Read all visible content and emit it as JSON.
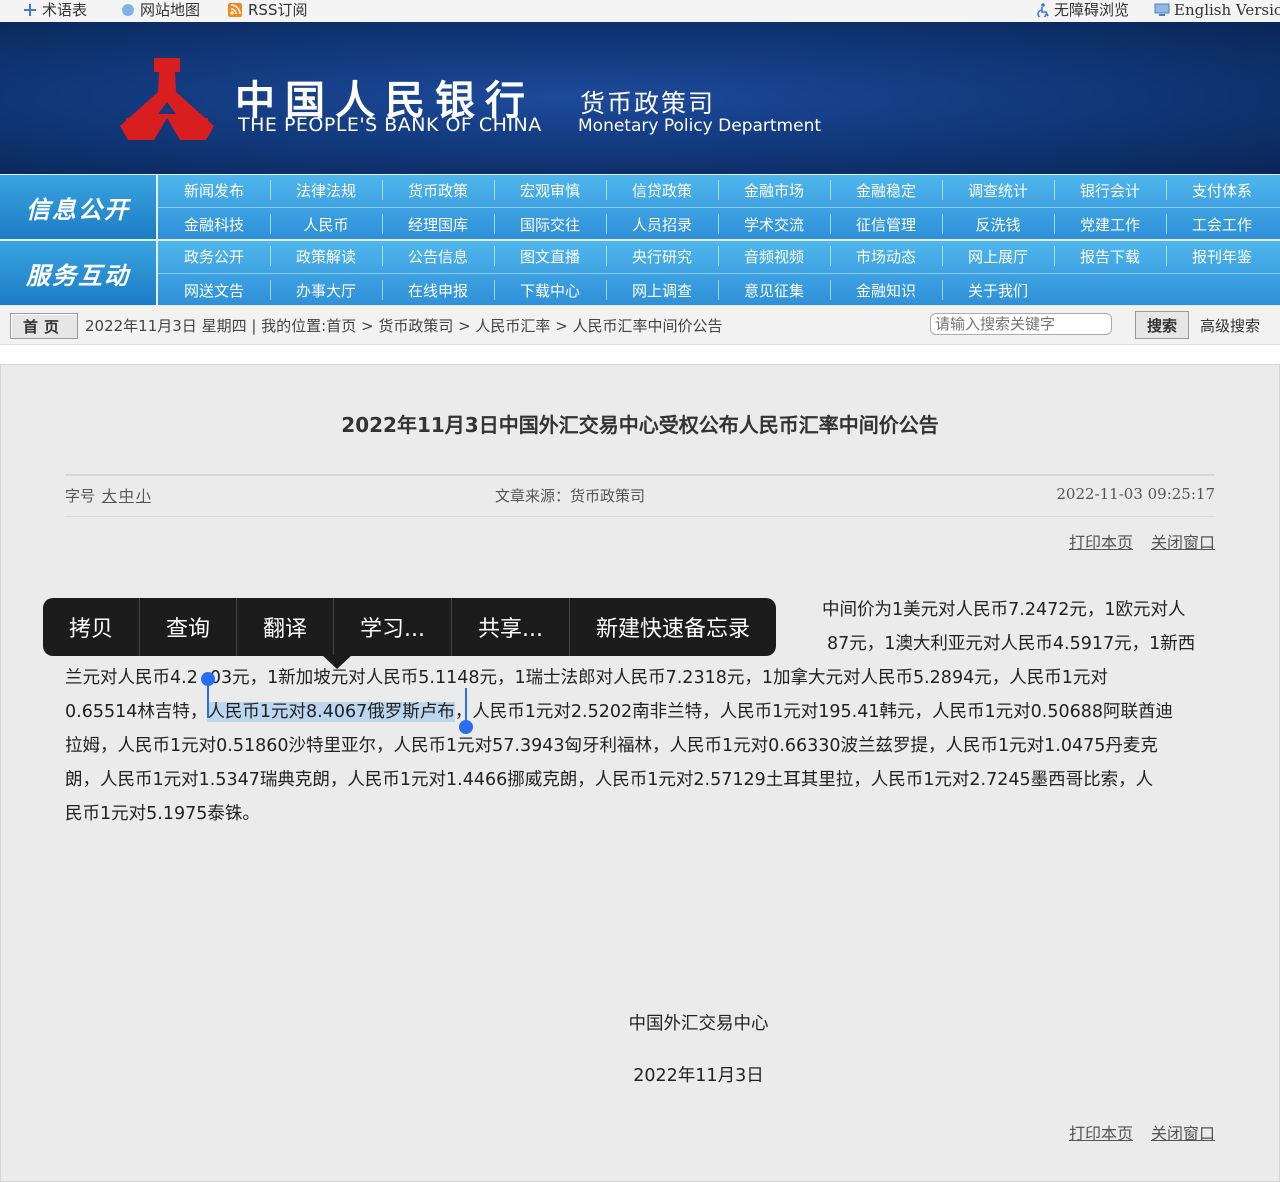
{
  "topbar": {
    "glossary": "术语表",
    "sitemap": "网站地图",
    "rss": "RSS订阅",
    "accessibility": "无障碍浏览",
    "english": "English Version"
  },
  "header": {
    "bank_cn": "中国人民银行",
    "bank_en": "THE PEOPLE'S BANK OF CHINA",
    "dept_cn": "货币政策司",
    "dept_en": "Monetary Policy Department"
  },
  "nav": {
    "side1": "信息公开",
    "side2": "服务互动",
    "row1": [
      "新闻发布",
      "法律法规",
      "货币政策",
      "宏观审慎",
      "信贷政策",
      "金融市场",
      "金融稳定",
      "调查统计",
      "银行会计",
      "支付体系"
    ],
    "row2": [
      "金融科技",
      "人民币",
      "经理国库",
      "国际交往",
      "人员招录",
      "学术交流",
      "征信管理",
      "反洗钱",
      "党建工作",
      "工会工作"
    ],
    "row3": [
      "政务公开",
      "政策解读",
      "公告信息",
      "图文直播",
      "央行研究",
      "音频视频",
      "市场动态",
      "网上展厅",
      "报告下载",
      "报刊年鉴"
    ],
    "row4": [
      "网送文告",
      "办事大厅",
      "在线申报",
      "下载中心",
      "网上调查",
      "意见征集",
      "金融知识",
      "关于我们"
    ]
  },
  "crumbbar": {
    "home": "首页",
    "location": "2022年11月3日 星期四 | 我的位置:首页 > 货币政策司 > 人民币汇率 > 人民币汇率中间价公告",
    "search_placeholder": "请输入搜索关键字",
    "search_button": "搜索",
    "advanced_search": "高级搜索"
  },
  "article": {
    "title": "2022年11月3日中国外汇交易中心受权公布人民币汇率中间价公告",
    "font_size_label": "字号",
    "font_large": "大",
    "font_medium": "中",
    "font_small": "小",
    "source": "文章来源：货币政策司",
    "datetime": "2022-11-03 09:25:17",
    "print": "打印本页",
    "close": "关闭窗口",
    "line1": "中间价为1美元对人民币7.2472元，1欧元对人",
    "line2": "87元，1澳大利亚元对人民币4.5917元，1新西",
    "line3a": "兰元对人民币4.2",
    "line3b": "03元，1新加坡元对人民币5.1148元，1瑞士法郎对人民币7.2318元，1加拿大元对人民币5.2894元，人民币1元对",
    "line4a": "0.65514林吉特，",
    "line4sel": "人民币1元对8.4067俄罗斯卢布",
    "line4b": "，人民币1元对2.5202南非兰特，人民币1元对195.41韩元，人民币1元对0.50688阿联酋迪",
    "line5": "拉姆，人民币1元对0.51860沙特里亚尔，人民币1元对57.3943匈牙利福林，人民币1元对0.66330波兰兹罗提，人民币1元对1.0475丹麦克",
    "line6": "朗，人民币1元对1.5347瑞典克朗，人民币1元对1.4466挪威克朗，人民币1元对2.57129土耳其里拉，人民币1元对2.7245墨西哥比索，人",
    "line7": "民币1元对5.1975泰铢。",
    "signer": "中国外汇交易中心",
    "sign_date": "2022年11月3日"
  },
  "context_menu": [
    "拷贝",
    "查询",
    "翻译",
    "学习...",
    "共享...",
    "新建快速备忘录"
  ]
}
